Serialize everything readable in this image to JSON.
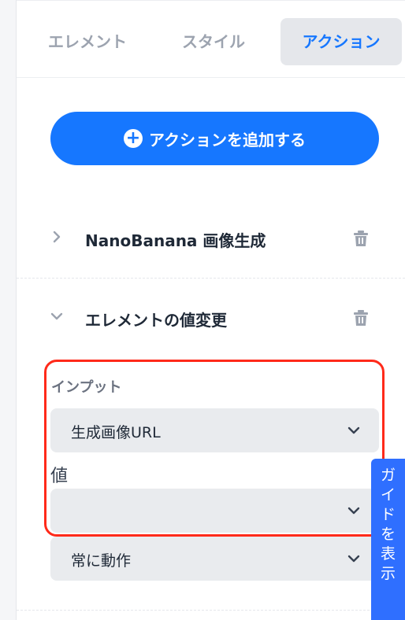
{
  "tabs": [
    {
      "label": "エレメント",
      "active": false
    },
    {
      "label": "スタイル",
      "active": false
    },
    {
      "label": "アクション",
      "active": true
    }
  ],
  "add_action": {
    "label": "アクションを追加する",
    "icon": "plus-circle-icon"
  },
  "actions": [
    {
      "title": "NanoBanana 画像生成",
      "expanded": false
    },
    {
      "title": "エレメントの値変更",
      "expanded": true
    }
  ],
  "input_section": {
    "label": "インプット",
    "input_select_value": "生成画像URL",
    "value_label": "値",
    "value_select_value": "",
    "trigger_select_value": "常に動作"
  },
  "guide": {
    "label": "ガイドを表示",
    "chars": [
      "ガ",
      "イ",
      "ド",
      "を",
      "表",
      "示"
    ]
  },
  "colors": {
    "accent": "#1677ff",
    "highlight": "#ff2a1a",
    "guide": "#2f6fff"
  }
}
